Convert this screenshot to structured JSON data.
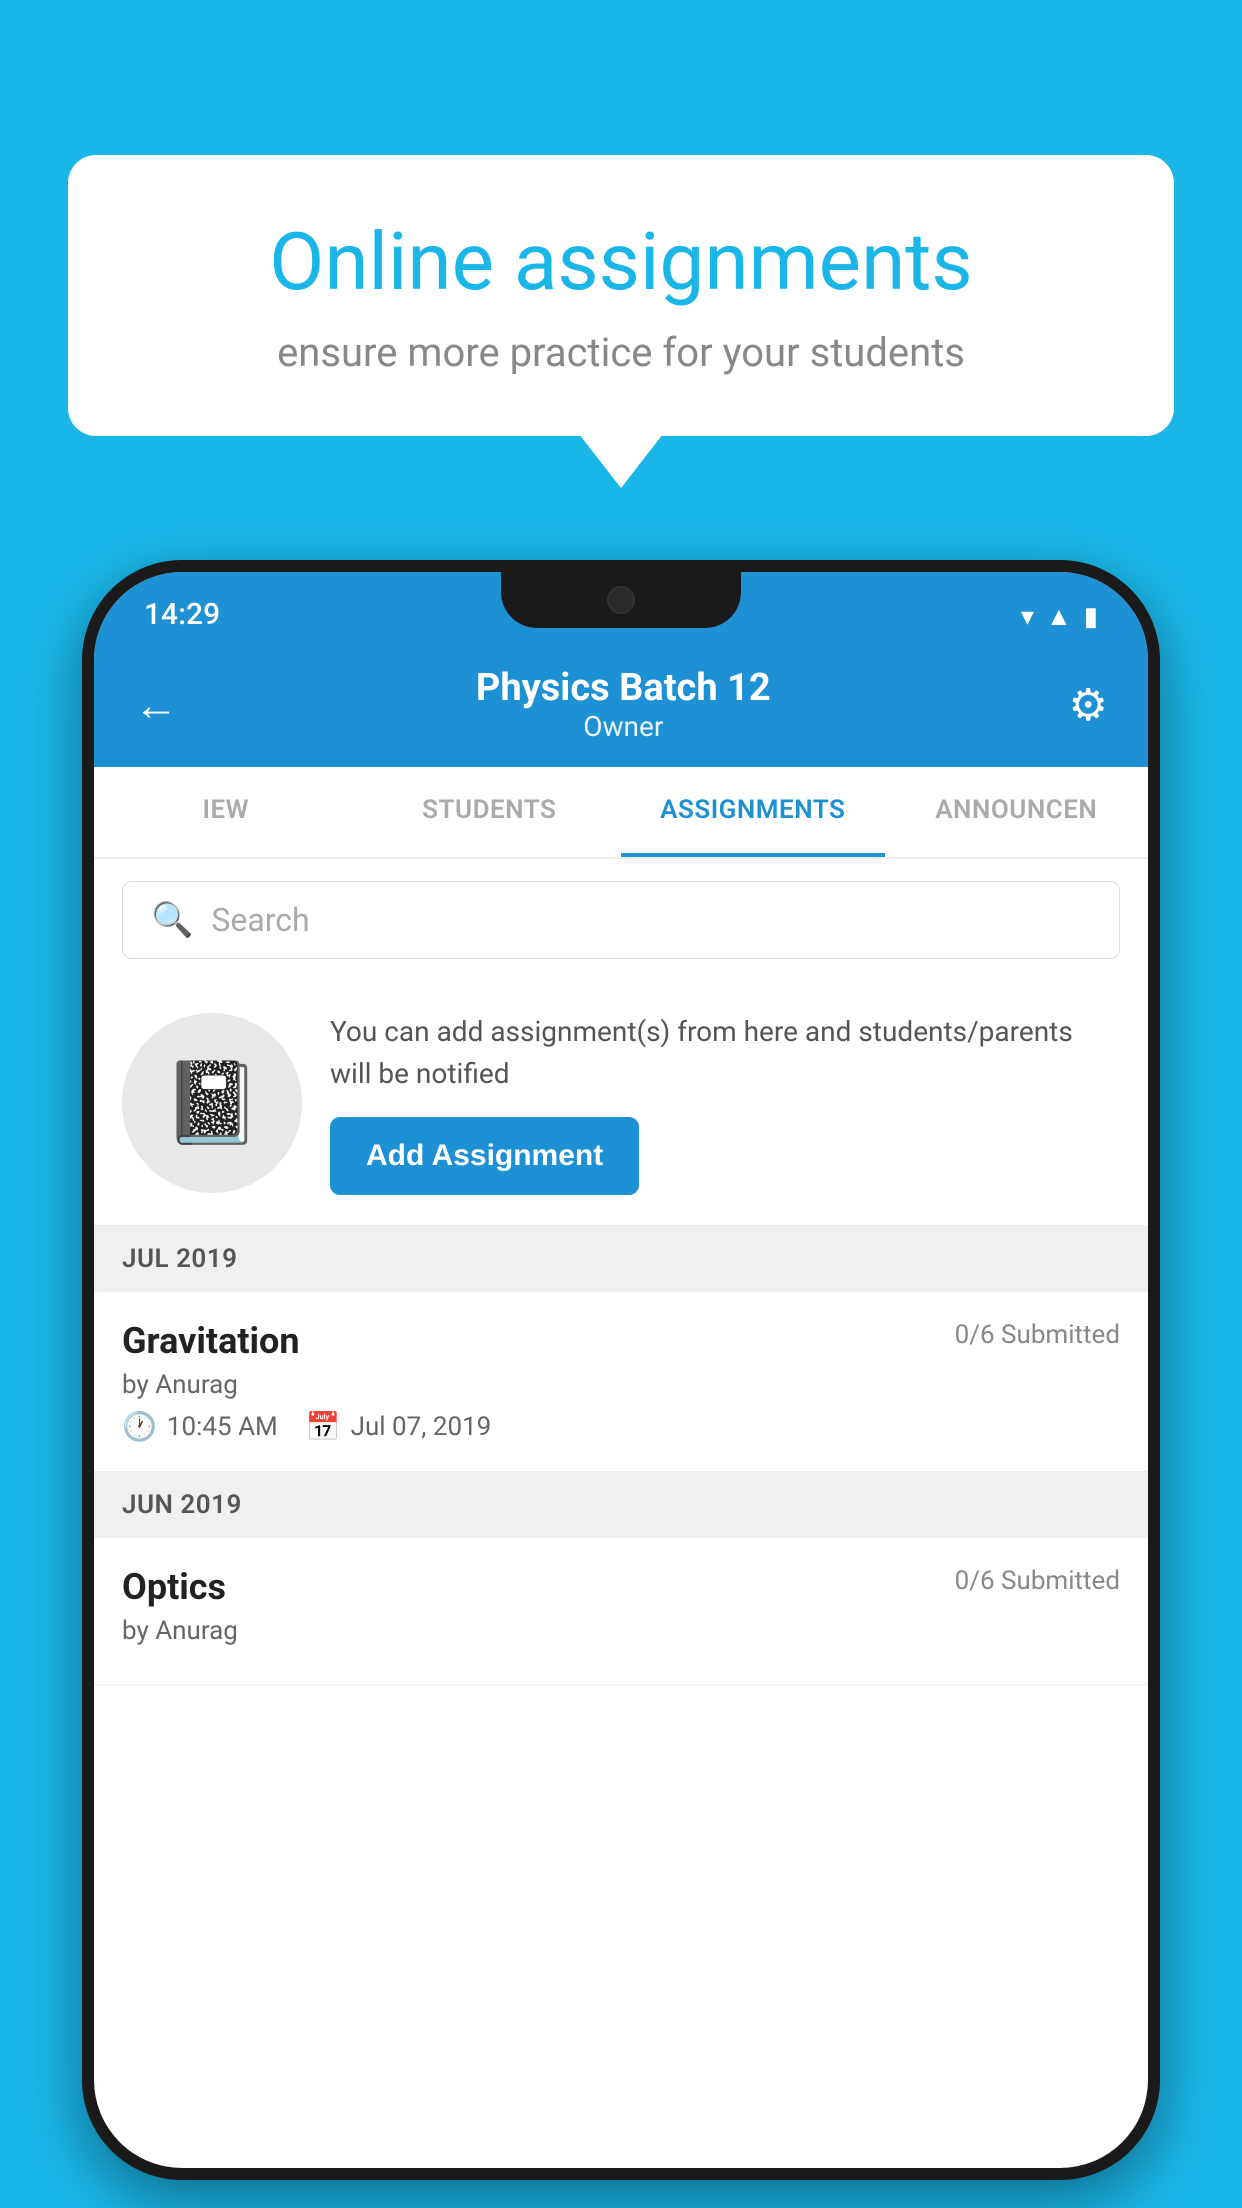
{
  "background": {
    "color": "#1ab6e8"
  },
  "speech_bubble": {
    "title": "Online assignments",
    "subtitle": "ensure more practice for your students"
  },
  "status_bar": {
    "time": "14:29",
    "icons": [
      "wifi",
      "signal",
      "battery"
    ]
  },
  "header": {
    "title": "Physics Batch 12",
    "subtitle": "Owner",
    "back_label": "←",
    "settings_label": "⚙"
  },
  "tabs": [
    {
      "label": "IEW",
      "active": false
    },
    {
      "label": "STUDENTS",
      "active": false
    },
    {
      "label": "ASSIGNMENTS",
      "active": true
    },
    {
      "label": "ANNOUNCEN",
      "active": false
    }
  ],
  "search": {
    "placeholder": "Search"
  },
  "promo": {
    "description": "You can add assignment(s) from here and students/parents will be notified",
    "button_label": "Add Assignment"
  },
  "sections": [
    {
      "label": "JUL 2019",
      "assignments": [
        {
          "title": "Gravitation",
          "submitted": "0/6 Submitted",
          "author": "by Anurag",
          "time": "10:45 AM",
          "date": "Jul 07, 2019"
        }
      ]
    },
    {
      "label": "JUN 2019",
      "assignments": [
        {
          "title": "Optics",
          "submitted": "0/6 Submitted",
          "author": "by Anurag",
          "time": "",
          "date": ""
        }
      ]
    }
  ]
}
